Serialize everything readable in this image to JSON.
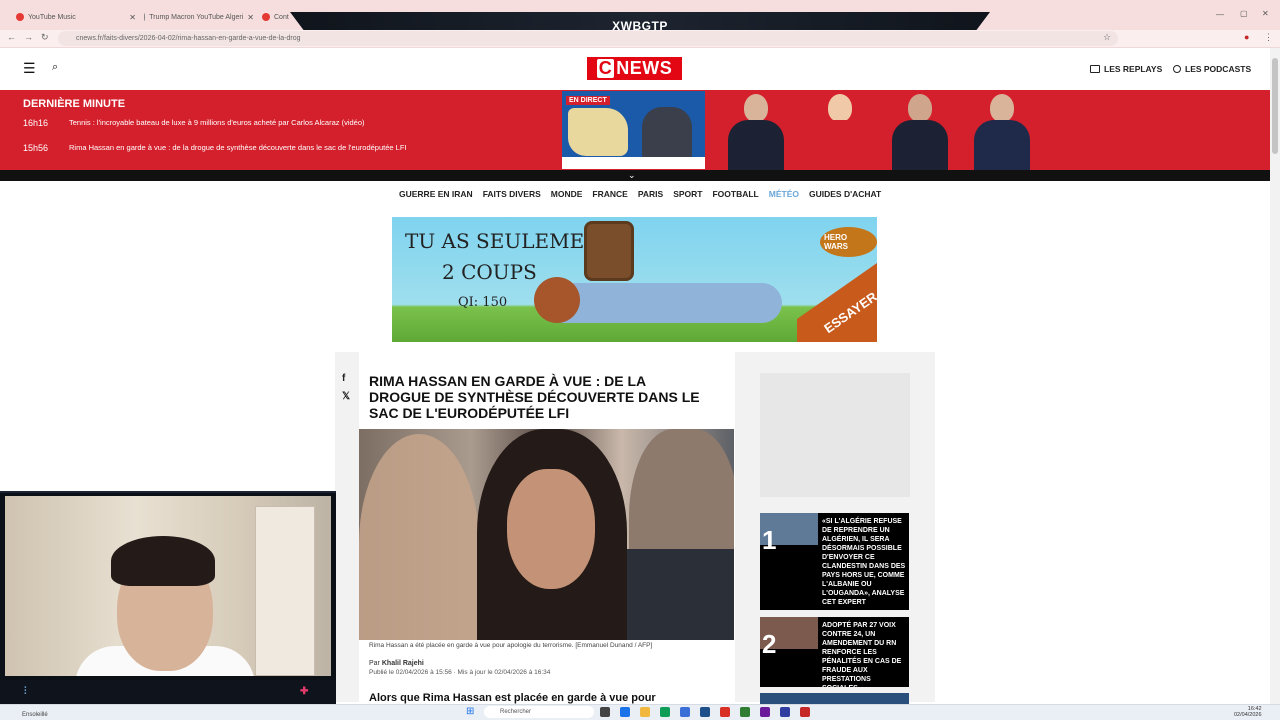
{
  "browser": {
    "tabs": [
      {
        "title": "YouTube Music"
      },
      {
        "title": "Trump Macron YouTube Algeri"
      },
      {
        "title": "Cont"
      }
    ],
    "url": "cnews.fr/faits-divers/2026-04-02/rima-hassan-en-garde-a-vue-de-la-drog"
  },
  "overlay_banner": {
    "title": "XWBGTP"
  },
  "header": {
    "logo": {
      "c": "C",
      "news": "NEWS"
    },
    "links": [
      {
        "label": "LES REPLAYS"
      },
      {
        "label": "LES PODCASTS"
      }
    ]
  },
  "breaking": {
    "title": "DERNIÈRE MINUTE",
    "items": [
      {
        "time": "16h16",
        "text": "Tennis : l'incroyable bateau de luxe à 9 millions d'euros acheté par Carlos Alcaraz (vidéo)"
      },
      {
        "time": "15h56",
        "text": "Rima Hassan en garde à vue : de la drogue de synthèse découverte dans le sac de l'eurodéputée LFI"
      }
    ],
    "live_badge": "EN DIRECT"
  },
  "nav": {
    "items": [
      {
        "label": "GUERRE EN IRAN"
      },
      {
        "label": "FAITS DIVERS"
      },
      {
        "label": "MONDE"
      },
      {
        "label": "FRANCE"
      },
      {
        "label": "PARIS"
      },
      {
        "label": "SPORT"
      },
      {
        "label": "FOOTBALL"
      },
      {
        "label": "MÉTÉO"
      },
      {
        "label": "GUIDES D'ACHAT"
      }
    ]
  },
  "ad": {
    "line1": "TU AS SEULEMENT",
    "line2": "2 COUPS",
    "line3": "QI: 150",
    "brand": "HERO WARS",
    "cta": "ESSAYER"
  },
  "article": {
    "title": "Rima Hassan en garde à vue : de la drogue de synthèse découverte dans le sac de l'eurodéputée LFI",
    "caption": "Rima Hassan a été placée en garde à vue pour apologie du terrorisme. [Emmanuel Dunand / AFP]",
    "byline_prefix": "Par",
    "author": "Khalil Rajehi",
    "dates": "Publié le 02/04/2026 à 15:56 · Mis à jour le 02/04/2026 à 16:34",
    "lead": "Alors que Rima Hassan est placée en garde à vue pour"
  },
  "sidebar_cards": [
    {
      "num": "1",
      "text": "«Si l'Algérie refuse de reprendre un Algérien, il sera désormais possible d'envoyer ce clandestin dans des pays hors UE, comme l'Albanie ou l'Ouganda», analyse cet expert"
    },
    {
      "num": "2",
      "text": "Adopté par 27 voix contre 24, un amendement du RN renforce les pénalités en cas de fraude aux prestations sociales"
    }
  ],
  "taskbar": {
    "search": "Rechercher",
    "time": "16:42",
    "date": "02/04/2026",
    "weather": "Ensoleillé"
  }
}
